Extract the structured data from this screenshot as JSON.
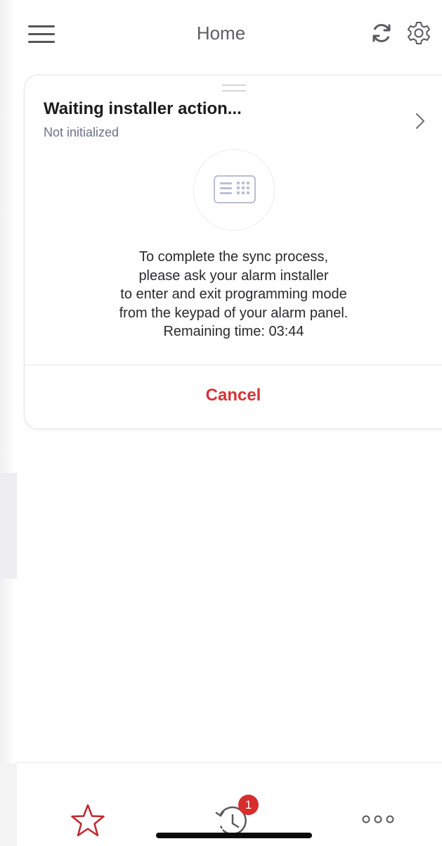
{
  "header": {
    "title": "Home",
    "menu_icon": "hamburger-menu-icon",
    "sync_icon": "sync-icon",
    "settings_icon": "gear-icon"
  },
  "status_card": {
    "title": "Waiting installer action...",
    "subtitle": "Not initialized",
    "device_icon": "keypad-icon",
    "message_lines": [
      "To complete the sync process,",
      "please ask your alarm installer",
      "to enter and exit programming mode",
      "from the keypad of your alarm panel.",
      "Remaining time: 03:44"
    ],
    "cancel_label": "Cancel"
  },
  "tabbar": {
    "favorites_icon": "star-icon",
    "history_icon": "history-icon",
    "history_badge": "1",
    "more_icon": "more-dots-icon"
  },
  "colors": {
    "accent_red": "#d63337",
    "badge_red": "#d62d2d",
    "subtitle_gray": "#6c7388"
  }
}
